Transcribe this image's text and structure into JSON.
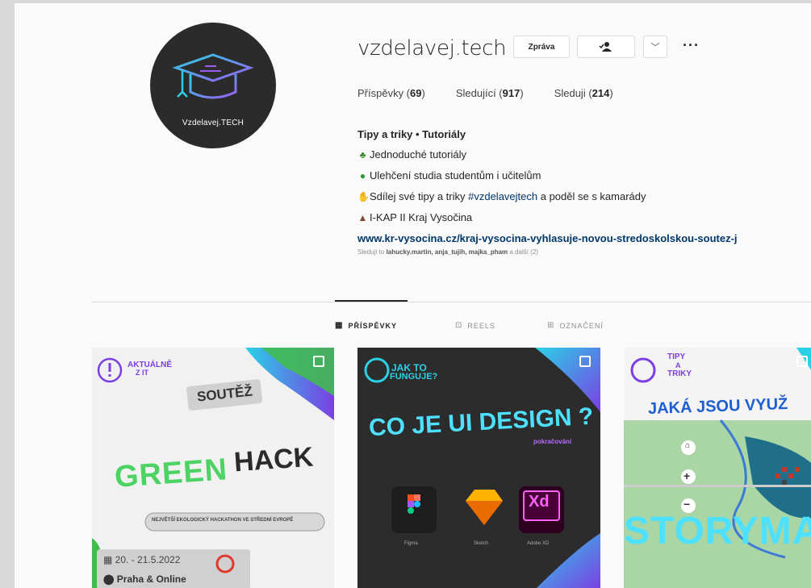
{
  "profile": {
    "username": "vzdelavej.tech",
    "avatar_text": "Vzdelavej.TECH",
    "message_button": "Zpráva",
    "chevron": "﹀",
    "more": "···"
  },
  "stats": {
    "posts_label": "Příspěvky (",
    "posts_value": "69",
    "followers_label": "Sledující (",
    "followers_value": "917",
    "following_label": "Sleduji (",
    "following_value": "214",
    "close": ")"
  },
  "bio": {
    "name": "Tipy a triky • Tutoriály",
    "line1": "Jednoduché tutoriály",
    "line2": "Ulehčení studia studentům i učitelům",
    "line3_a": "Sdílej své tipy a triky ",
    "line3_tag": "#vzdelavejtech",
    "line3_b": " a poděl se s kamarády",
    "line4": "I-KAP II Kraj Vysočina",
    "link": "www.kr-vysocina.cz/kraj-vysocina-vyhlasuje-novou-stredoskolskou-soutez-j",
    "followed_prefix": "Sledují to ",
    "followed_names": "lahucky.martin, anja_tujih, majka_pham",
    "followed_suffix": " a další (2)"
  },
  "tabs": [
    {
      "label": "PŘÍSPĚVKY",
      "icon": "grid-icon"
    },
    {
      "label": "REELS",
      "icon": "reels-icon"
    },
    {
      "label": "OZNAČENÍ",
      "icon": "tagged-icon"
    }
  ],
  "posts": {
    "p1": {
      "tag": "AKTUÁLNĚ",
      "tag2": "Z IT",
      "soutez": "SOUTĚŽ",
      "green": "GREEN",
      "hack": "HACK",
      "banner": "NEJVĚTŠÍ EKOLOGICKÝ HACKATHON VE STŘEDNÍ EVROPĚ",
      "date": "20. - 21.5.2022",
      "place": "Praha & Online"
    },
    "p2": {
      "tag": "JAK TO",
      "tag2": "FUNGUJE?",
      "title": "CO JE UI DESIGN ?",
      "sub": "pokračování",
      "apps": [
        "Figma",
        "Sketch",
        "Adobe XD"
      ],
      "xd": "Xd"
    },
    "p3": {
      "tag": "TIPY",
      "tag2": "A",
      "tag3": "TRIKY",
      "headline": "JAKÁ JSOU VYUŽ",
      "big": "STORYMA",
      "plus": "+",
      "minus": "−"
    }
  },
  "colors": {
    "link": "#00376b",
    "gradient_purple": "#7b3fe4",
    "gradient_cyan": "#2ad1e6",
    "green": "#3fbf4a"
  }
}
